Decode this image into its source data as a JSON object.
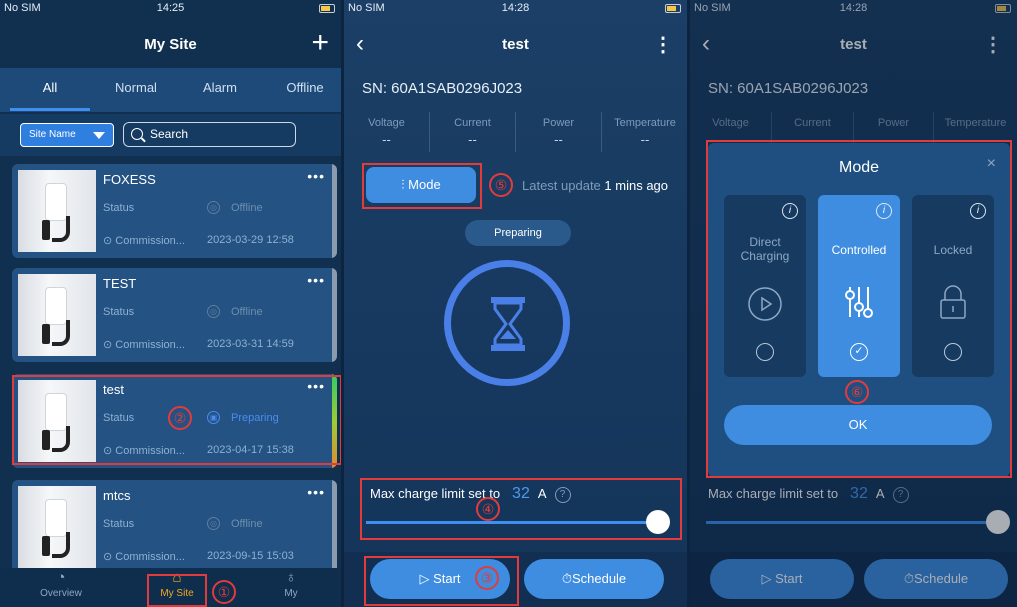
{
  "status": {
    "carrier": "No SIM",
    "time1": "14:25",
    "time2": "14:28",
    "time3": "14:28"
  },
  "p1": {
    "title": "My Site",
    "plus": "+",
    "tabs": [
      "All",
      "Normal",
      "Alarm",
      "Offline"
    ],
    "site_name_filter": "Site Name",
    "search_placeholder": "Search",
    "status_label": "Status",
    "commission_label": "Commission...",
    "cards": [
      {
        "name": "FOXESS",
        "status": "Offline",
        "date": "2023-03-29 12:58"
      },
      {
        "name": "TEST",
        "status": "Offline",
        "date": "2023-03-31 14:59"
      },
      {
        "name": "test",
        "status": "Preparing",
        "date": "2023-04-17 15:38"
      },
      {
        "name": "mtcs",
        "status": "Offline",
        "date": "2023-09-15 15:03"
      }
    ],
    "nav": [
      "Overview",
      "My Site",
      "My"
    ]
  },
  "detail": {
    "title": "test",
    "sn": "SN:  60A1SAB0296J023",
    "metrics": [
      {
        "label": "Voltage",
        "value": "--"
      },
      {
        "label": "Current",
        "value": "--"
      },
      {
        "label": "Power",
        "value": "--"
      },
      {
        "label": "Temperature",
        "value": "--"
      }
    ],
    "mode_label": "Mode",
    "latest_prefix": "Latest update",
    "latest_value": "1 mins ago",
    "state": "Preparing",
    "max_label": "Max charge limit set to",
    "max_value": "32",
    "max_unit": "A",
    "max_fraction": 1.0,
    "start": "Start",
    "schedule": "Schedule"
  },
  "modal": {
    "title": "Mode",
    "close": "×",
    "options": [
      {
        "label": "Direct Charging",
        "selected": false
      },
      {
        "label": "Controlled",
        "selected": true
      },
      {
        "label": "Locked",
        "selected": false
      }
    ],
    "ok": "OK"
  },
  "markers": [
    "①",
    "②",
    "③",
    "④",
    "⑤",
    "⑥"
  ]
}
